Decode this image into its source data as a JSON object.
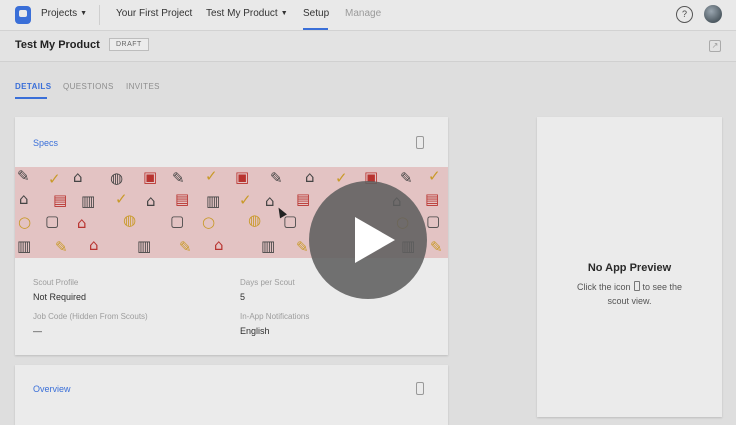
{
  "nav": {
    "projects": "Projects",
    "your_first_project": "Your First Project",
    "test_my_product": "Test My Product",
    "setup": "Setup",
    "manage": "Manage",
    "help": "?"
  },
  "header": {
    "title": "Test My Product",
    "badge": "DRAFT"
  },
  "tabs": [
    "DETAILS",
    "QUESTIONS",
    "INVITES"
  ],
  "specs": {
    "title": "Specs",
    "fields": [
      {
        "label": "Scout Profile",
        "value": "Not Required"
      },
      {
        "label": "Days per Scout",
        "value": "5"
      },
      {
        "label": "Job Code (Hidden From Scouts)",
        "value": "—"
      },
      {
        "label": "In-App Notifications",
        "value": "English"
      }
    ]
  },
  "overview": {
    "title": "Overview"
  },
  "preview": {
    "title": "No App Preview",
    "line1_before": "Click the icon",
    "line1_after": "to see the",
    "line2": "scout view."
  },
  "colors": {
    "accent": "#3a6fd8",
    "banner": "#e3c3c3",
    "doodle_red": "#b8332f",
    "doodle_dark": "#444444",
    "doodle_gold": "#c99a2a"
  }
}
